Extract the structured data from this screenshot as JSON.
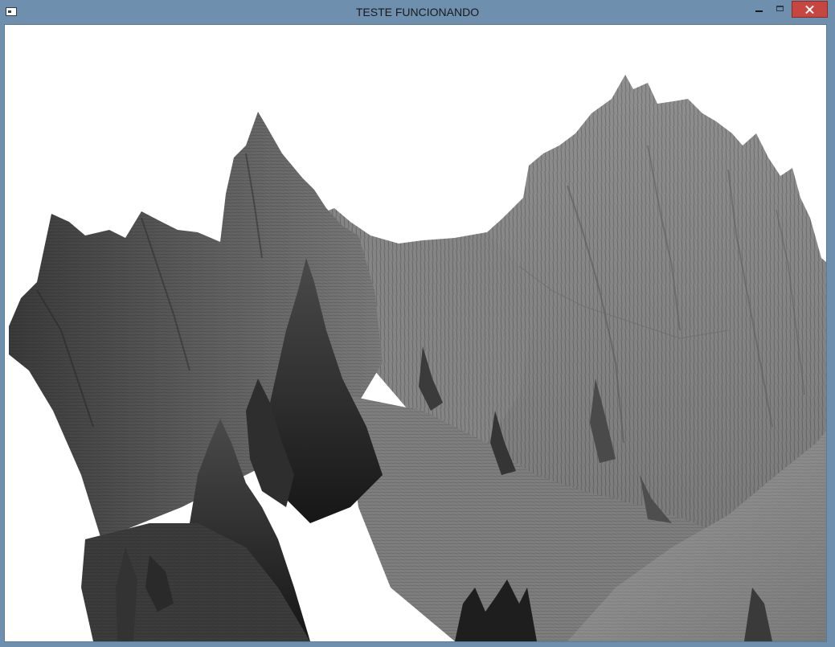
{
  "window": {
    "title": "TESTE FUNCIONANDO",
    "icons": {
      "app": "app-window-icon",
      "minimize": "minimize-icon",
      "maximize": "maximize-icon",
      "close": "close-icon"
    },
    "accent_color": "#6e8fae",
    "close_color": "#c7463f"
  },
  "scene": {
    "description_type": "3d-terrain-render",
    "background_color": "#ffffff",
    "terrain_color": "#8a8a8a"
  }
}
